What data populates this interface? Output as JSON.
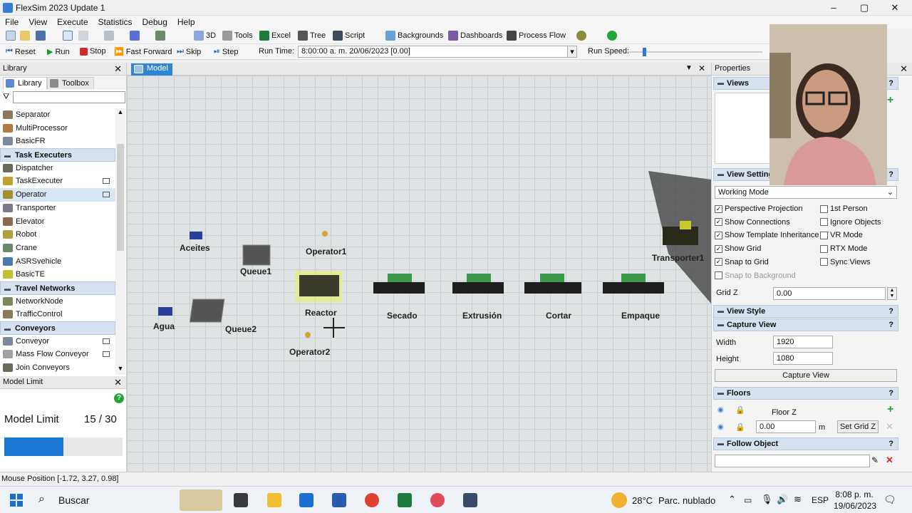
{
  "window": {
    "title": "FlexSim 2023 Update 1",
    "min": "–",
    "max": "▢",
    "close": "✕"
  },
  "menu": [
    "File",
    "View",
    "Execute",
    "Statistics",
    "Debug",
    "Help"
  ],
  "toolbar1": {
    "btn_3d": "3D",
    "tools": "Tools",
    "excel": "Excel",
    "tree": "Tree",
    "script": "Script",
    "backgrounds": "Backgrounds",
    "dashboards": "Dashboards",
    "process_flow": "Process Flow"
  },
  "toolbar2": {
    "reset": "Reset",
    "run": "Run",
    "stop": "Stop",
    "fast_forward": "Fast Forward",
    "skip": "Skip",
    "step": "Step",
    "run_time_label": "Run Time:",
    "run_time_value": "8:00:00 a. m.  20/06/2023  [0.00]",
    "run_speed_label": "Run Speed:"
  },
  "library": {
    "title": "Library",
    "tabs": [
      "Library",
      "Toolbox"
    ],
    "search_placeholder": "",
    "items": [
      {
        "type": "item",
        "label": "Separator"
      },
      {
        "type": "item",
        "label": "MultiProcessor"
      },
      {
        "type": "item",
        "label": "BasicFR"
      },
      {
        "type": "cat",
        "label": "Task Executers"
      },
      {
        "type": "item",
        "label": "Dispatcher"
      },
      {
        "type": "item",
        "label": "TaskExecuter",
        "dock": true
      },
      {
        "type": "item",
        "label": "Operator",
        "dock": true,
        "selected": true
      },
      {
        "type": "item",
        "label": "Transporter"
      },
      {
        "type": "item",
        "label": "Elevator"
      },
      {
        "type": "item",
        "label": "Robot"
      },
      {
        "type": "item",
        "label": "Crane"
      },
      {
        "type": "item",
        "label": "ASRSvehicle"
      },
      {
        "type": "item",
        "label": "BasicTE"
      },
      {
        "type": "cat",
        "label": "Travel Networks"
      },
      {
        "type": "item",
        "label": "NetworkNode"
      },
      {
        "type": "item",
        "label": "TrafficControl"
      },
      {
        "type": "cat",
        "label": "Conveyors"
      },
      {
        "type": "item",
        "label": "Conveyor",
        "dock": true
      },
      {
        "type": "item",
        "label": "Mass Flow Conveyor",
        "dock": true
      },
      {
        "type": "item",
        "label": "Join Conveyors"
      }
    ]
  },
  "model_limit": {
    "title": "Model Limit",
    "label": "Model Limit",
    "value": "15 / 30",
    "used": 15,
    "max": 30
  },
  "model_tab": {
    "label": "Model"
  },
  "model_objects": {
    "aceites": "Aceites",
    "operator1": "Operator1",
    "queue1": "Queue1",
    "transporter1": "Transporter1",
    "reactor": "Reactor",
    "secado": "Secado",
    "extrusion": "Extrusión",
    "cortar": "Cortar",
    "empaque": "Empaque",
    "agua": "Agua",
    "queue2": "Queue2",
    "operator2": "Operator2"
  },
  "properties": {
    "title": "Properties",
    "views_label": "Views",
    "view_settings_label": "View Settings",
    "working_mode": "Working Mode",
    "checks_left": [
      {
        "label": "Perspective Projection",
        "checked": true
      },
      {
        "label": "Show Connections",
        "checked": true
      },
      {
        "label": "Show Template Inheritance (T",
        "checked": true
      },
      {
        "label": "Show Grid",
        "checked": true
      },
      {
        "label": "Snap to Grid",
        "checked": true
      },
      {
        "label": "Snap to Background",
        "checked": false
      }
    ],
    "checks_right": [
      {
        "label": "1st Person",
        "checked": false
      },
      {
        "label": "Ignore Objects",
        "checked": false
      },
      {
        "label": "VR Mode",
        "checked": false
      },
      {
        "label": "RTX Mode",
        "checked": false
      },
      {
        "label": "Sync Views",
        "checked": false
      }
    ],
    "grid_z_label": "Grid Z",
    "grid_z_value": "0.00",
    "view_style_label": "View Style",
    "capture_view_label": "Capture View",
    "width_label": "Width",
    "width_value": "1920",
    "height_label": "Height",
    "height_value": "1080",
    "capture_button": "Capture View",
    "floors_label": "Floors",
    "floor_z_label": "Floor Z",
    "floor_z_value": "0.00",
    "floor_unit": "m",
    "set_grid_z": "Set Grid Z",
    "follow_object_label": "Follow Object",
    "q": "?"
  },
  "status": {
    "mouse_position": "Mouse Position [-1.72, 3.27, 0.98]"
  },
  "taskbar": {
    "search": "Buscar",
    "temp": "28°C",
    "weather": "Parc. nublado",
    "lang": "ESP",
    "time": "8:08 p. m.",
    "date": "19/06/2023"
  },
  "colors": {
    "accent": "#2f86d6",
    "category_bg": "#d6e2f0",
    "model_limit_fill": "#1a78d2"
  }
}
